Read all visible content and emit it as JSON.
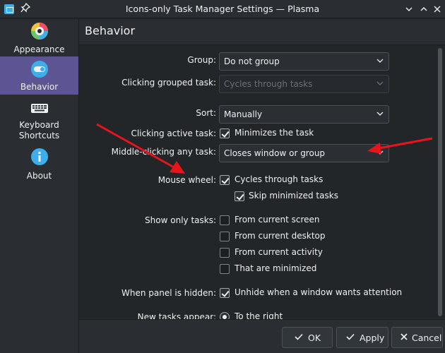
{
  "window": {
    "title": "Icons-only Task Manager Settings — Plasma",
    "controls": [
      "chevron-down-icon",
      "chevron-up-icon",
      "close-icon"
    ]
  },
  "sidebar": {
    "items": [
      {
        "label": "Appearance",
        "icon": "appearance-icon",
        "active": false
      },
      {
        "label": "Behavior",
        "icon": "behavior-toggle-icon",
        "active": true
      },
      {
        "label_line1": "Keyboard",
        "label_line2": "Shortcuts",
        "icon": "keyboard-icon",
        "active": false
      },
      {
        "label": "About",
        "icon": "info-icon",
        "active": false
      }
    ]
  },
  "page": {
    "title": "Behavior"
  },
  "form": {
    "group": {
      "label": "Group:",
      "value": "Do not group"
    },
    "clicking_grouped": {
      "label": "Clicking grouped task:",
      "value": "Cycles through tasks",
      "disabled": true
    },
    "sort": {
      "label": "Sort:",
      "value": "Manually"
    },
    "clicking_active": {
      "label": "Clicking active task:",
      "option": "Minimizes the task",
      "checked": true
    },
    "middle_clicking": {
      "label": "Middle-clicking any task:",
      "value": "Closes window or group"
    },
    "mouse_wheel": {
      "label": "Mouse wheel:",
      "option": "Cycles through tasks",
      "checked": true,
      "sub_option": "Skip minimized tasks",
      "sub_checked": true
    },
    "show_only": {
      "label": "Show only tasks:",
      "options": [
        {
          "text": "From current screen",
          "checked": false
        },
        {
          "text": "From current desktop",
          "checked": false
        },
        {
          "text": "From current activity",
          "checked": false
        },
        {
          "text": "That are minimized",
          "checked": false
        }
      ]
    },
    "panel_hidden": {
      "label": "When panel is hidden:",
      "option": "Unhide when a window wants attention",
      "checked": true
    },
    "new_tasks": {
      "label": "New tasks appear:",
      "option": "To the right",
      "selected": true
    }
  },
  "footer": {
    "ok_label": "OK",
    "apply_label": "Apply",
    "cancel_label": "Cancel"
  },
  "colors": {
    "accent": "#5d5493",
    "annotation_arrow": "#e8141c",
    "background": "#232629"
  }
}
